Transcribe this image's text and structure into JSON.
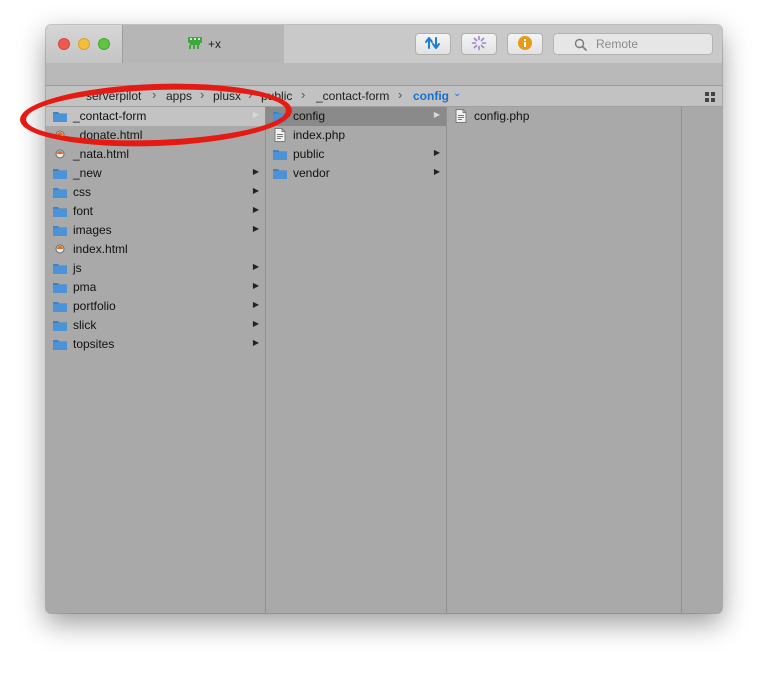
{
  "window": {
    "tab_label": "+x",
    "search_placeholder": "Remote"
  },
  "path": {
    "crumbs": [
      "serverpilot",
      "apps",
      "plusx",
      "public",
      "_contact-form",
      "config"
    ]
  },
  "columns": {
    "col1": [
      {
        "name": "_contact-form",
        "type": "folder",
        "chevron": true,
        "selected": true
      },
      {
        "name": "_donate.html",
        "type": "html",
        "chevron": false
      },
      {
        "name": "_nata.html",
        "type": "html",
        "chevron": false
      },
      {
        "name": "_new",
        "type": "folder",
        "chevron": true
      },
      {
        "name": "css",
        "type": "folder",
        "chevron": true
      },
      {
        "name": "font",
        "type": "folder",
        "chevron": true
      },
      {
        "name": "images",
        "type": "folder",
        "chevron": true
      },
      {
        "name": "index.html",
        "type": "html",
        "chevron": false
      },
      {
        "name": "js",
        "type": "folder",
        "chevron": true
      },
      {
        "name": "pma",
        "type": "folder",
        "chevron": true
      },
      {
        "name": "portfolio",
        "type": "folder",
        "chevron": true
      },
      {
        "name": "slick",
        "type": "folder",
        "chevron": true
      },
      {
        "name": "topsites",
        "type": "folder",
        "chevron": true
      }
    ],
    "col2": [
      {
        "name": "config",
        "type": "folder",
        "chevron": true,
        "selected": true
      },
      {
        "name": "index.php",
        "type": "php",
        "chevron": false
      },
      {
        "name": "public",
        "type": "folder",
        "chevron": true
      },
      {
        "name": "vendor",
        "type": "folder",
        "chevron": true
      }
    ],
    "col3": [
      {
        "name": "config.php",
        "type": "php",
        "chevron": false
      }
    ]
  },
  "colors": {
    "accent": "#1a6fd0",
    "annotation": "#e51a13",
    "folder": "#3d83c6"
  }
}
